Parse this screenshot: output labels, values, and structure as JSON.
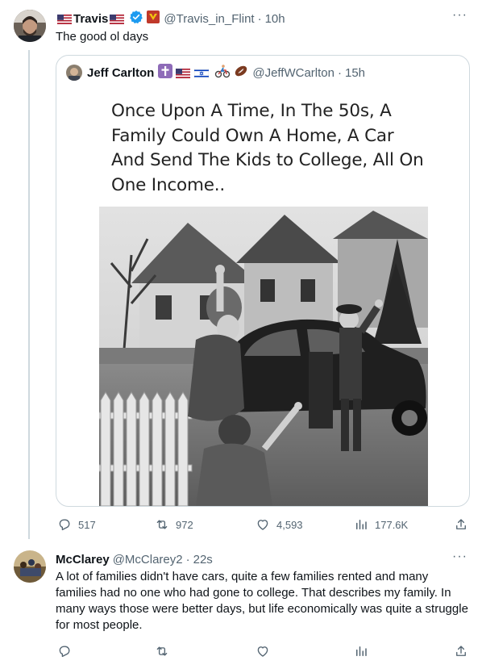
{
  "tweet1": {
    "flag_left": "us-flag-icon",
    "display_name": "Travis",
    "flag_right": "us-flag-icon",
    "handle": "@Travis_in_Flint",
    "separator": "·",
    "time": "10h",
    "text": "The good ol days",
    "quote": {
      "display_name": "Jeff Carlton",
      "handle": "@JeffWCarlton",
      "separator": "·",
      "time": "15h",
      "image_text": "Once Upon A Time, In The 50s, A Family Could Own A Home, A Car And Send The Kids to College, All On One Income.."
    },
    "actions": {
      "replies": "517",
      "retweets": "972",
      "likes": "4,593",
      "views": "177.6K"
    }
  },
  "tweet2": {
    "display_name": "McClarey",
    "handle": "@McClarey2",
    "separator": "·",
    "time": "22s",
    "text": "A lot of families didn't have cars, quite a few families rented and many families had no one who had gone to college.  That describes my family.  In many ways those were better days, but life economically was quite a struggle for most people."
  },
  "colors": {
    "verified_blue": "#1d9bf0",
    "muted": "#536471",
    "border": "#cfd9de"
  }
}
